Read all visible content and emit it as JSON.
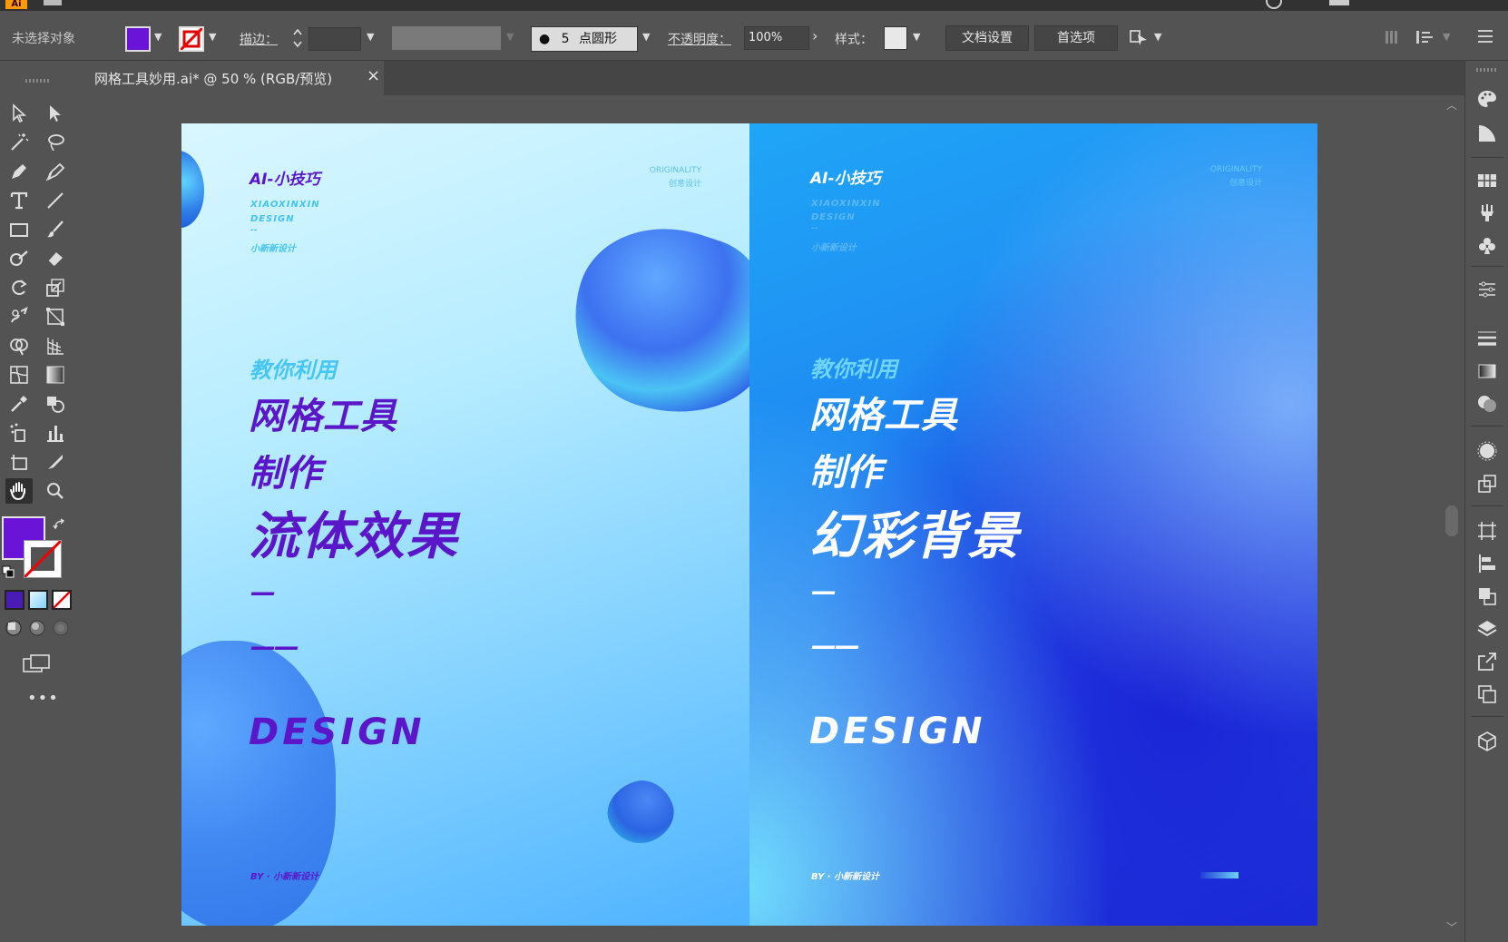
{
  "toolbar_top": {
    "selection_status": "未选择对象",
    "stroke_label": "描边：",
    "brush_size": "5",
    "brush_shape": "点圆形",
    "opacity_label": "不透明度：",
    "opacity_value": "100%",
    "style_label": "样式：",
    "doc_setup": "文档设置",
    "preferences": "首选项"
  },
  "document": {
    "tab_title": "网格工具妙用.ai* @ 50 % (RGB/预览)",
    "close": "×"
  },
  "artboard_left": {
    "brand": "AI-小技巧",
    "originality": "ORIGINALITY",
    "creative": "创意设计",
    "sub1": "XIAOXINXIN",
    "sub2": "DESIGN",
    "dash": "--",
    "sub3": "小新新设计",
    "line1": "教你利用",
    "line2": "网格工具",
    "line3": "制作",
    "line4": "流体效果",
    "short_dash": "—",
    "double_dash": "——",
    "design": "DESIGN",
    "by": "BY · 小新新设计"
  },
  "artboard_right": {
    "brand": "AI-小技巧",
    "originality": "ORIGINALITY",
    "creative": "创意设计",
    "sub1": "XIAOXINXIN",
    "sub2": "DESIGN",
    "dash": "--",
    "sub3": "小新新设计",
    "line1": "教你利用",
    "line2": "网格工具",
    "line3": "制作",
    "line4": "幻彩背景",
    "short_dash": "—",
    "double_dash": "——",
    "design": "DESIGN",
    "by": "BY · 小新新设计"
  },
  "colors": {
    "fill": "#6a14d8",
    "purple_text": "#5a16c8",
    "cyan_text": "#47c6f2",
    "white_text": "#ffffff"
  },
  "icons": {
    "left_tools": [
      "selection-tool",
      "direct-selection-tool",
      "magic-wand-tool",
      "lasso-tool",
      "pen-tool",
      "curvature-tool",
      "type-tool",
      "line-tool",
      "rectangle-tool",
      "paintbrush-tool",
      "shaper-tool",
      "eraser-tool",
      "rotate-tool",
      "scale-tool",
      "warp-tool",
      "free-transform-tool",
      "shape-builder-tool",
      "perspective-grid-tool",
      "mesh-tool",
      "gradient-tool",
      "eyedropper-tool",
      "blend-tool",
      "symbol-sprayer-tool",
      "column-graph-tool",
      "artboard-tool",
      "slice-tool",
      "hand-tool",
      "zoom-tool"
    ],
    "right_panels": [
      "color-panel",
      "color-guide-panel",
      "swatches-panel",
      "brushes-panel",
      "symbols-panel",
      "graphic-styles-panel",
      "stroke-panel",
      "gradient-panel",
      "transparency-panel",
      "appearance-panel",
      "transform-panel",
      "align-panel",
      "pathfinder-panel",
      "layers-panel",
      "asset-export-panel",
      "artboards-panel",
      "3d-panel"
    ]
  }
}
